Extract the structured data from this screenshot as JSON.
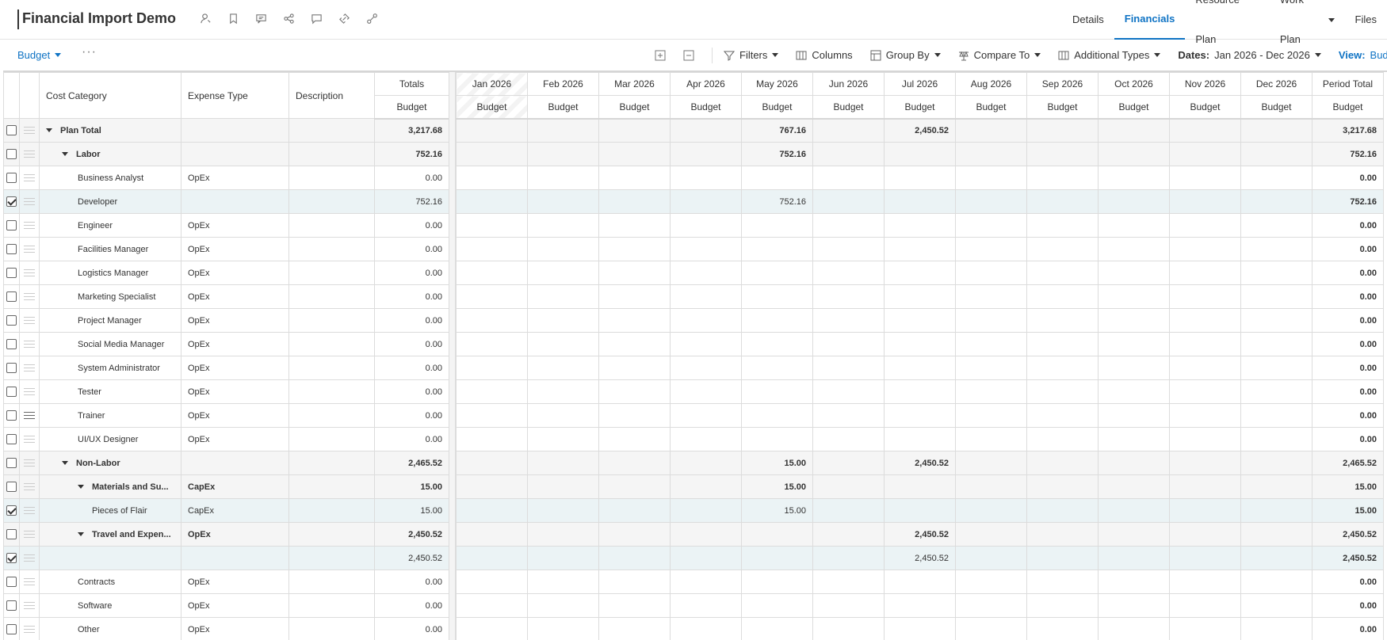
{
  "app": {
    "title": "Financial Import Demo"
  },
  "header_icons": [
    "person-icon",
    "bookmark-icon",
    "comment-list-icon",
    "share-icon",
    "chat-icon",
    "link-icon",
    "chain-icon"
  ],
  "nav_tabs": [
    {
      "label": "Details",
      "active": false
    },
    {
      "label": "Financials",
      "active": true
    },
    {
      "label": "Resource Plan",
      "active": false
    },
    {
      "label": "Work Plan",
      "active": false,
      "has_dropdown": true
    },
    {
      "label": "Files",
      "active": false
    }
  ],
  "toolbar": {
    "view_select": "Budget",
    "more": "···",
    "filters": "Filters",
    "columns": "Columns",
    "group_by": "Group By",
    "compare_to": "Compare To",
    "additional_types": "Additional Types",
    "dates_label": "Dates:",
    "dates_value": "Jan 2026 - Dec 2026",
    "view_label": "View:",
    "view_value": "Bud"
  },
  "colors": {
    "accent": "#0f73c4",
    "selected_row": "#ebf3f5",
    "group_row": "#f5f5f5"
  },
  "left_headers": {
    "cost_category": "Cost Category",
    "expense_type": "Expense Type",
    "description": "Description",
    "totals": "Totals",
    "budget": "Budget"
  },
  "months": [
    "Jan 2026",
    "Feb 2026",
    "Mar 2026",
    "Apr 2026",
    "May 2026",
    "Jun 2026",
    "Jul 2026",
    "Aug 2026",
    "Sep 2026",
    "Oct 2026",
    "Nov 2026",
    "Dec 2026",
    "Period Total"
  ],
  "sub_header": "Budget",
  "rows": [
    {
      "name": "Plan Total",
      "level": 0,
      "group": true,
      "expense": "",
      "total": "3,217.68",
      "checked": false,
      "m": {
        "4": "767.16",
        "6": "2,450.52"
      },
      "period": "3,217.68"
    },
    {
      "name": "Labor",
      "level": 1,
      "group": true,
      "expense": "",
      "total": "752.16",
      "checked": false,
      "m": {
        "4": "752.16"
      },
      "period": "752.16"
    },
    {
      "name": "Business Analyst",
      "level": 2,
      "group": false,
      "expense": "OpEx",
      "total": "0.00",
      "checked": false,
      "m": {},
      "period": "0.00"
    },
    {
      "name": "Developer",
      "level": 2,
      "group": false,
      "expense": "",
      "total": "752.16",
      "checked": true,
      "m": {
        "4": "752.16"
      },
      "period": "752.16"
    },
    {
      "name": "Engineer",
      "level": 2,
      "group": false,
      "expense": "OpEx",
      "total": "0.00",
      "checked": false,
      "m": {},
      "period": "0.00"
    },
    {
      "name": "Facilities Manager",
      "level": 2,
      "group": false,
      "expense": "OpEx",
      "total": "0.00",
      "checked": false,
      "m": {},
      "period": "0.00"
    },
    {
      "name": "Logistics Manager",
      "level": 2,
      "group": false,
      "expense": "OpEx",
      "total": "0.00",
      "checked": false,
      "m": {},
      "period": "0.00"
    },
    {
      "name": "Marketing Specialist",
      "level": 2,
      "group": false,
      "expense": "OpEx",
      "total": "0.00",
      "checked": false,
      "m": {},
      "period": "0.00"
    },
    {
      "name": "Project Manager",
      "level": 2,
      "group": false,
      "expense": "OpEx",
      "total": "0.00",
      "checked": false,
      "m": {},
      "period": "0.00"
    },
    {
      "name": "Social Media Manager",
      "level": 2,
      "group": false,
      "expense": "OpEx",
      "total": "0.00",
      "checked": false,
      "m": {},
      "period": "0.00"
    },
    {
      "name": "System Administrator",
      "level": 2,
      "group": false,
      "expense": "OpEx",
      "total": "0.00",
      "checked": false,
      "m": {},
      "period": "0.00"
    },
    {
      "name": "Tester",
      "level": 2,
      "group": false,
      "expense": "OpEx",
      "total": "0.00",
      "checked": false,
      "m": {},
      "period": "0.00"
    },
    {
      "name": "Trainer",
      "level": 2,
      "group": false,
      "expense": "OpEx",
      "total": "0.00",
      "checked": false,
      "dark_handle": true,
      "m": {},
      "period": "0.00"
    },
    {
      "name": "UI/UX Designer",
      "level": 2,
      "group": false,
      "expense": "OpEx",
      "total": "0.00",
      "checked": false,
      "m": {},
      "period": "0.00"
    },
    {
      "name": "Non-Labor",
      "level": 1,
      "group": true,
      "expense": "",
      "total": "2,465.52",
      "checked": false,
      "m": {
        "4": "15.00",
        "6": "2,450.52"
      },
      "period": "2,465.52"
    },
    {
      "name": "Materials and Su...",
      "level": 2,
      "group": true,
      "expense": "CapEx",
      "total": "15.00",
      "checked": false,
      "m": {
        "4": "15.00"
      },
      "period": "15.00"
    },
    {
      "name": "Pieces of Flair",
      "level": 3,
      "group": false,
      "expense": "CapEx",
      "total": "15.00",
      "checked": true,
      "m": {
        "4": "15.00"
      },
      "period": "15.00"
    },
    {
      "name": "Travel and Expen...",
      "level": 2,
      "group": true,
      "expense": "OpEx",
      "total": "2,450.52",
      "checked": false,
      "m": {
        "6": "2,450.52"
      },
      "period": "2,450.52"
    },
    {
      "name": "",
      "level": 3,
      "group": false,
      "expense": "",
      "total": "2,450.52",
      "checked": true,
      "m": {
        "6": "2,450.52"
      },
      "period": "2,450.52"
    },
    {
      "name": "Contracts",
      "level": 2,
      "group": false,
      "expense": "OpEx",
      "total": "0.00",
      "checked": false,
      "m": {},
      "period": "0.00"
    },
    {
      "name": "Software",
      "level": 2,
      "group": false,
      "expense": "OpEx",
      "total": "0.00",
      "checked": false,
      "m": {},
      "period": "0.00"
    },
    {
      "name": "Other",
      "level": 2,
      "group": false,
      "expense": "OpEx",
      "total": "0.00",
      "checked": false,
      "m": {},
      "period": "0.00"
    }
  ]
}
